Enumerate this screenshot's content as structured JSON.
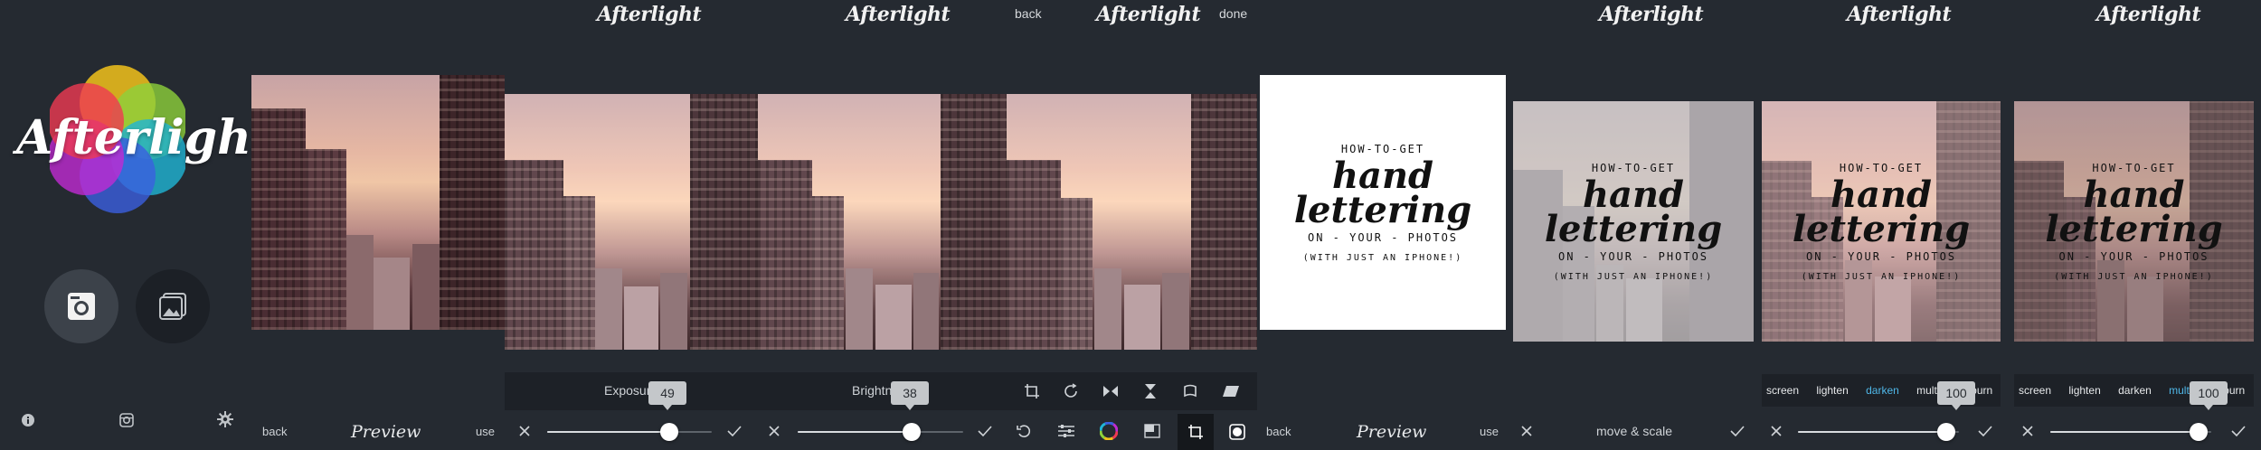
{
  "brand": {
    "logo_text": "Afterlight",
    "title_1": "Afterlight",
    "title_2": "Afterlight",
    "title_3": "Afterlight",
    "title_4": "Afterlight",
    "title_5": "Afterlight",
    "title_6": "Afterlight"
  },
  "home_panel": {
    "camera_icon": "camera-icon",
    "library_icon": "photo-library-icon",
    "info_icon": "info-icon",
    "instagram_icon": "instagram-icon",
    "settings_icon": "gear-icon"
  },
  "preview_panel_1": {
    "back_label": "back",
    "title": "Preview",
    "use_label": "use"
  },
  "exposure_panel": {
    "label": "Exposure",
    "value": "49",
    "level": 0.74
  },
  "brightness_panel": {
    "label": "Brightness",
    "value": "38",
    "level": 0.69
  },
  "transform_panel": {
    "back_label": "back",
    "done_label": "done",
    "tools": [
      "crop-icon",
      "rotate-icon",
      "flip-horizontal-icon",
      "flip-vertical-icon",
      "skew-icon",
      "perspective-icon"
    ],
    "bottom_tools": [
      "undo-icon",
      "adjust-icon",
      "color-wheel-icon",
      "frames-icon",
      "crop-icon",
      "double-exposure-icon"
    ]
  },
  "preview_panel_2": {
    "back_label": "back",
    "title": "Preview",
    "use_label": "use"
  },
  "lettering": {
    "line1": "HOW-TO-GET",
    "line2": "hand",
    "line3": "lettering",
    "line4": "ON - YOUR - PHOTOS",
    "line5": "(WITH JUST AN IPHONE!)"
  },
  "move_panel": {
    "label": "move & scale"
  },
  "blend_panel_1": {
    "modes": [
      "screen",
      "lighten",
      "darken",
      "multiply",
      "burn"
    ],
    "active": "darken",
    "value": "100",
    "level": 0.92
  },
  "blend_panel_2": {
    "modes": [
      "screen",
      "lighten",
      "darken",
      "multiply",
      "burn"
    ],
    "active": "multiply",
    "value": "100",
    "level": 0.92
  },
  "colors": {
    "background": "#252a31",
    "toolbar": "#1d2127",
    "accent_blue": "#4fb7e8",
    "slider_knob": "#ffffff"
  }
}
